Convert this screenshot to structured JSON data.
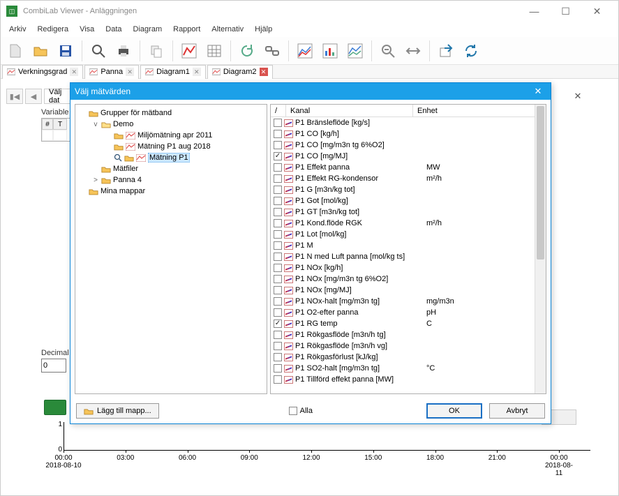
{
  "window": {
    "title": "CombiLab Viewer - Anläggningen"
  },
  "menu": [
    "Arkiv",
    "Redigera",
    "Visa",
    "Data",
    "Diagram",
    "Rapport",
    "Alternativ",
    "Hjälp"
  ],
  "tabs": [
    {
      "label": "Verkningsgrad",
      "active": false
    },
    {
      "label": "Panna",
      "active": false
    },
    {
      "label": "Diagram1",
      "active": false
    },
    {
      "label": "Diagram2",
      "active": true
    }
  ],
  "subnav_label": "Välj dat",
  "bg_panel": {
    "label": "Variable",
    "header_a": "#",
    "header_b": "T",
    "decimal_label": "Decimal",
    "decimal_value": "0"
  },
  "chart_data": {
    "type": "line",
    "yticks": [
      "1",
      "0"
    ],
    "xticks": [
      "00:00",
      "03:00",
      "06:00",
      "09:00",
      "12:00",
      "15:00",
      "18:00",
      "21:00",
      "00:00"
    ],
    "x_start_date": "2018-08-10",
    "x_end_date": "2018-08-11"
  },
  "dialog": {
    "title": "Välj mätvärden",
    "tree": [
      {
        "indent": 0,
        "type": "folder",
        "label": "Grupper för mätband",
        "toggle": ""
      },
      {
        "indent": 1,
        "type": "folder-open",
        "label": "Demo",
        "toggle": "v"
      },
      {
        "indent": 2,
        "type": "folder-sig",
        "label": "Miljömätning apr 2011",
        "toggle": ""
      },
      {
        "indent": 2,
        "type": "folder-sig",
        "label": "Mätning P1 aug 2018",
        "toggle": ""
      },
      {
        "indent": 2,
        "type": "folder-sig-search",
        "label": "Mätning P1",
        "toggle": "",
        "selected": true
      },
      {
        "indent": 1,
        "type": "folder",
        "label": "Mätfiler",
        "toggle": ""
      },
      {
        "indent": 1,
        "type": "folder",
        "label": "Panna 4",
        "toggle": ">"
      },
      {
        "indent": 0,
        "type": "folder",
        "label": "Mina mappar",
        "toggle": ""
      }
    ],
    "columns": {
      "a": "/",
      "b": "Kanal",
      "c": "Enhet"
    },
    "rows": [
      {
        "checked": false,
        "kanal": "P1 Bränsleflöde [kg/s]",
        "enhet": ""
      },
      {
        "checked": false,
        "kanal": "P1 CO [kg/h]",
        "enhet": ""
      },
      {
        "checked": false,
        "kanal": "P1 CO [mg/m3n tg 6%O2]",
        "enhet": ""
      },
      {
        "checked": true,
        "kanal": "P1 CO [mg/MJ]",
        "enhet": ""
      },
      {
        "checked": false,
        "kanal": "P1 Effekt panna",
        "enhet": "MW"
      },
      {
        "checked": false,
        "kanal": "P1 Effekt RG-kondensor",
        "enhet": "m²/h"
      },
      {
        "checked": false,
        "kanal": "P1 G [m3n/kg tot]",
        "enhet": ""
      },
      {
        "checked": false,
        "kanal": "P1 Got [mol/kg]",
        "enhet": ""
      },
      {
        "checked": false,
        "kanal": "P1 GT [m3n/kg tot]",
        "enhet": ""
      },
      {
        "checked": false,
        "kanal": "P1 Kond.flöde RGK",
        "enhet": "m²/h"
      },
      {
        "checked": false,
        "kanal": "P1 Lot [mol/kg]",
        "enhet": ""
      },
      {
        "checked": false,
        "kanal": "P1 M",
        "enhet": ""
      },
      {
        "checked": false,
        "kanal": "P1 N med Luft panna [mol/kg ts]",
        "enhet": ""
      },
      {
        "checked": false,
        "kanal": "P1 NOx [kg/h]",
        "enhet": ""
      },
      {
        "checked": false,
        "kanal": "P1 NOx [mg/m3n tg 6%O2]",
        "enhet": ""
      },
      {
        "checked": false,
        "kanal": "P1 NOx [mg/MJ]",
        "enhet": ""
      },
      {
        "checked": false,
        "kanal": "P1 NOx-halt [mg/m3n tg]",
        "enhet": "mg/m3n"
      },
      {
        "checked": false,
        "kanal": "P1 O2-efter panna",
        "enhet": "pH"
      },
      {
        "checked": true,
        "kanal": "P1 RG temp",
        "enhet": "C"
      },
      {
        "checked": false,
        "kanal": "P1 Rökgasflöde [m3n/h tg]",
        "enhet": ""
      },
      {
        "checked": false,
        "kanal": "P1 Rökgasflöde [m3n/h vg]",
        "enhet": ""
      },
      {
        "checked": false,
        "kanal": "P1 Rökgasförlust [kJ/kg]",
        "enhet": ""
      },
      {
        "checked": false,
        "kanal": "P1 SO2-halt [mg/m3n tg]",
        "enhet": "°C"
      },
      {
        "checked": false,
        "kanal": "P1 Tillförd effekt panna [MW]",
        "enhet": ""
      }
    ],
    "add_folder": "Lägg till mapp...",
    "alla": "Alla",
    "ok": "OK",
    "cancel": "Avbryt"
  }
}
